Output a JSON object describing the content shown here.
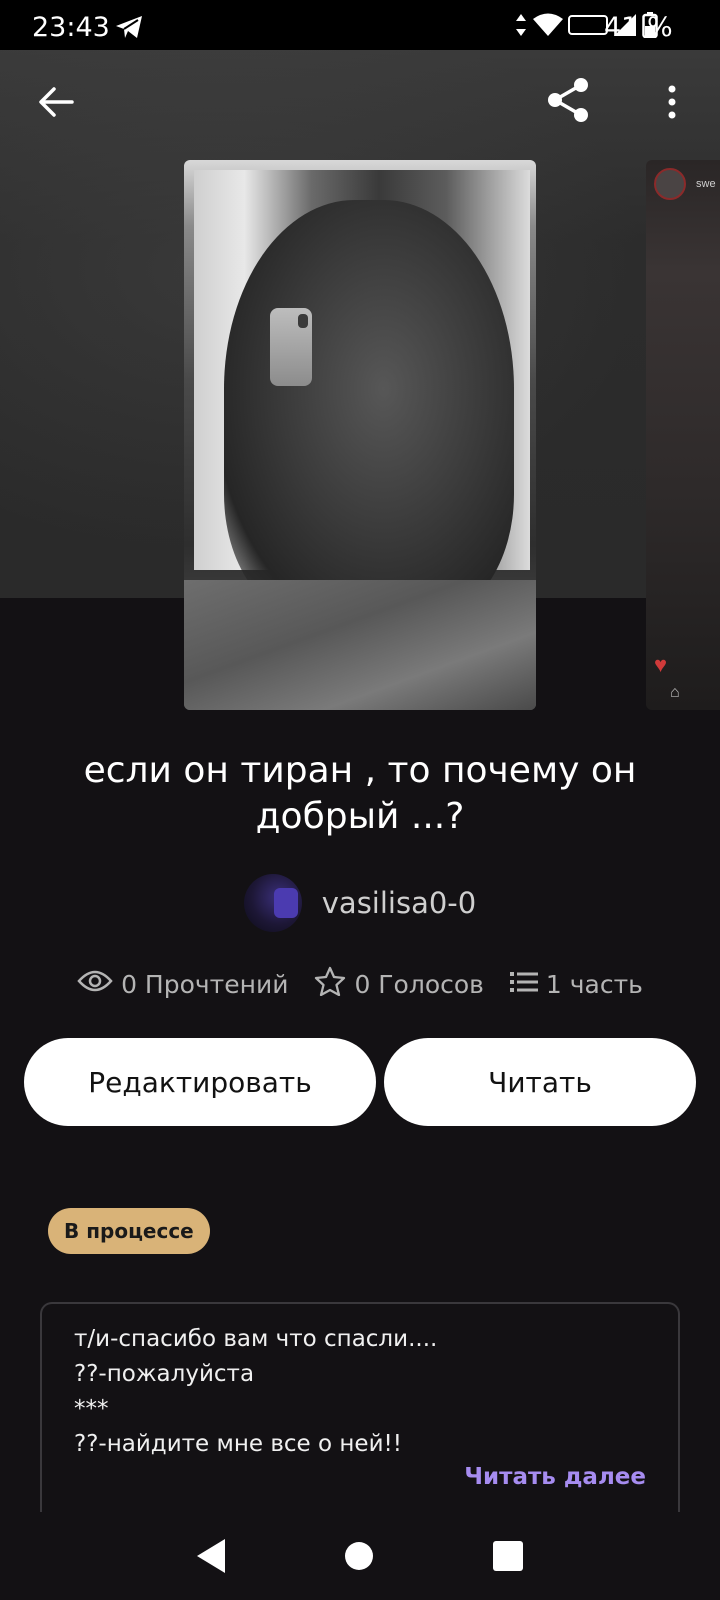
{
  "status_bar": {
    "time": "23:43",
    "battery": "41 %",
    "network_badge": "VoLTE",
    "icons": [
      "telegram-icon",
      "data-arrows-icon",
      "wifi-icon",
      "volte-icon",
      "signal-icon",
      "battery-icon"
    ]
  },
  "toolbar": {
    "back_icon": "arrow-left-icon",
    "share_icon": "share-icon",
    "more_icon": "more-vertical-icon"
  },
  "next_cover": {
    "label": "swe"
  },
  "story": {
    "title": "если он тиран , то почему он добрый ...?",
    "author": "vasilisa0-0",
    "reads": "0 Прочтений",
    "votes": "0 Голосов",
    "parts": "1 часть",
    "status": "В процессе"
  },
  "actions": {
    "edit_label": "Редактировать",
    "read_label": "Читать"
  },
  "description": {
    "lines": [
      "т/и-спасибо вам что спасли....",
      "??-пожалуйста",
      "***",
      "??-найдите мне все о ней!!"
    ],
    "read_more": "Читать далее"
  },
  "colors": {
    "background": "#131114",
    "status_chip": "#d9b378",
    "read_more": "#a68cf0",
    "button_bg": "#ffffff"
  }
}
